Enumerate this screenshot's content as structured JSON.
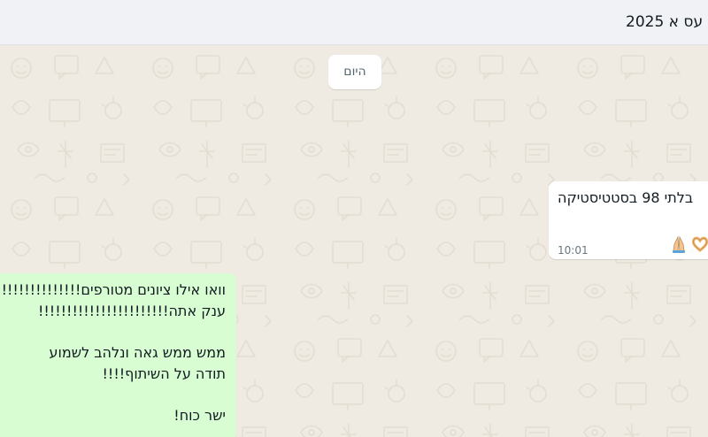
{
  "header": {
    "title": "עס א 2025"
  },
  "chat": {
    "date_chip": "היום",
    "incoming_message": {
      "text": "בלתי 98 בסטטיסטיקה",
      "emojis": [
        "folded-hands-icon",
        "heart-hands-icon"
      ],
      "time": "10:01"
    },
    "outgoing_message": {
      "lines": [
        "וואו אילו ציונים מטורפים!!!!!!!!!!!!!!!!!!",
        "ענק אתה!!!!!!!!!!!!!!!!!!!!!!!",
        "ממש ממש גאה ונלהב לשמוע",
        "תודה על השיתוף!!!!",
        "ישר כוח!"
      ]
    }
  },
  "colors": {
    "header_bg": "#f0f2f5",
    "chat_bg": "#efeae2",
    "incoming_bubble": "#ffffff",
    "outgoing_bubble": "#d9fdd3",
    "text": "#111b21",
    "meta_text": "#667781"
  }
}
